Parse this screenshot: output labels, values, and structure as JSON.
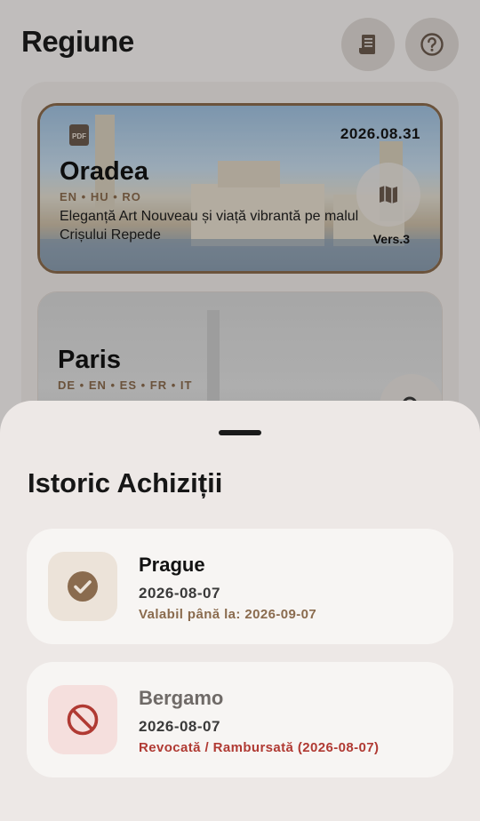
{
  "header": {
    "title": "Regiune",
    "receipt_icon": "receipt-icon",
    "help_icon": "help-icon"
  },
  "regions": [
    {
      "name": "Oradea",
      "languages": "EN • HU • RO",
      "description": "Eleganță Art Nouveau și viață vibrantă pe malul Crișului Repede",
      "date": "2026.08.31",
      "version": "Vers.3",
      "selected": true
    },
    {
      "name": "Paris",
      "languages": "DE • EN • ES • FR • IT"
    }
  ],
  "sheet": {
    "title": "Istoric Achiziții",
    "purchases": [
      {
        "name": "Prague",
        "date": "2026-08-07",
        "status": "Valabil până la: 2026-09-07",
        "state": "valid"
      },
      {
        "name": "Bergamo",
        "date": "2026-08-07",
        "status": "Revocată / Rambursată (2026-08-07)",
        "state": "revoked"
      }
    ]
  },
  "colors": {
    "accent": "#8a6b4e",
    "error": "#b03a33",
    "sheet_bg": "#ede8e6"
  }
}
